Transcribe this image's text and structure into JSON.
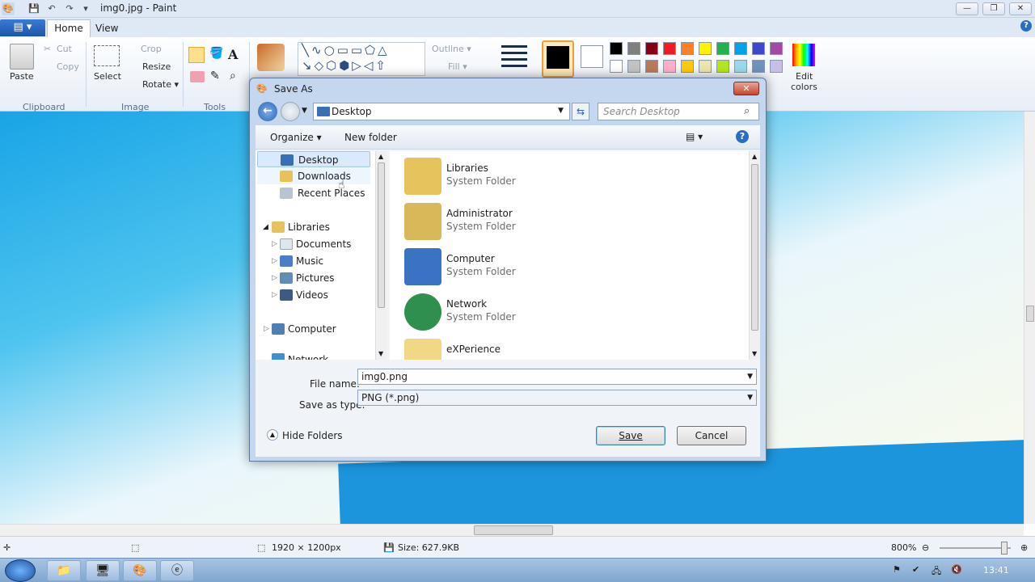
{
  "window": {
    "title": "img0.jpg - Paint"
  },
  "tabs": {
    "file": "▤ ▾",
    "home": "Home",
    "view": "View"
  },
  "ribbon": {
    "paste": "Paste",
    "cut": "Cut",
    "copy": "Copy",
    "select": "Select",
    "crop": "Crop",
    "resize": "Resize",
    "rotate": "Rotate ▾",
    "outline": "Outline ▾",
    "fill": "Fill ▾",
    "edit_colors_1": "Edit",
    "edit_colors_2": "colors",
    "groups": {
      "clipboard": "Clipboard",
      "image": "Image",
      "tools": "Tools"
    },
    "palette_row1": [
      "#000000",
      "#7f7f7f",
      "#880015",
      "#ed1c24",
      "#ff7f27",
      "#fff200",
      "#22b14c",
      "#00a2e8",
      "#3f48cc",
      "#a349a4"
    ],
    "palette_row2": [
      "#ffffff",
      "#c3c3c3",
      "#b97a57",
      "#ffaec9",
      "#ffc90e",
      "#efe4b0",
      "#b5e61d",
      "#99d9ea",
      "#7092be",
      "#c8bfe7"
    ]
  },
  "dialog": {
    "title": "Save As",
    "address": "Desktop",
    "search_placeholder": "Search Desktop",
    "organize": "Organize ▾",
    "new_folder": "New folder",
    "nav": [
      {
        "label": "Desktop",
        "color": "#3b6fb5"
      },
      {
        "label": "Downloads",
        "color": "#e8c15a"
      },
      {
        "label": "Recent Places",
        "color": "#b8c4d1"
      },
      {
        "label": "Libraries",
        "color": "#e6c25c"
      },
      {
        "label": "Documents",
        "color": "#dfe6ee"
      },
      {
        "label": "Music",
        "color": "#4b7ec6"
      },
      {
        "label": "Pictures",
        "color": "#5f8fb8"
      },
      {
        "label": "Videos",
        "color": "#3e5a82"
      },
      {
        "label": "Computer",
        "color": "#4f7fb0"
      },
      {
        "label": "Network",
        "color": "#3c8fd1"
      }
    ],
    "items": [
      {
        "name": "Libraries",
        "sub": "System Folder",
        "color": "#e7c35d"
      },
      {
        "name": "Administrator",
        "sub": "System Folder",
        "color": "#d9b85a"
      },
      {
        "name": "Computer",
        "sub": "System Folder",
        "color": "#3b73c2"
      },
      {
        "name": "Network",
        "sub": "System Folder",
        "color": "#2f8f4e"
      },
      {
        "name": "eXPerience",
        "sub": "",
        "color": "#f0d887"
      }
    ],
    "file_name_label": "File name:",
    "file_name": "img0.png",
    "save_type_label": "Save as type:",
    "save_type": "PNG (*.png)",
    "hide_folders": "Hide Folders",
    "save": "Save",
    "cancel": "Cancel"
  },
  "status": {
    "dimensions": "1920 × 1200px",
    "size": "Size: 627.9KB",
    "zoom": "800%"
  },
  "taskbar": {
    "time": "13:41"
  }
}
